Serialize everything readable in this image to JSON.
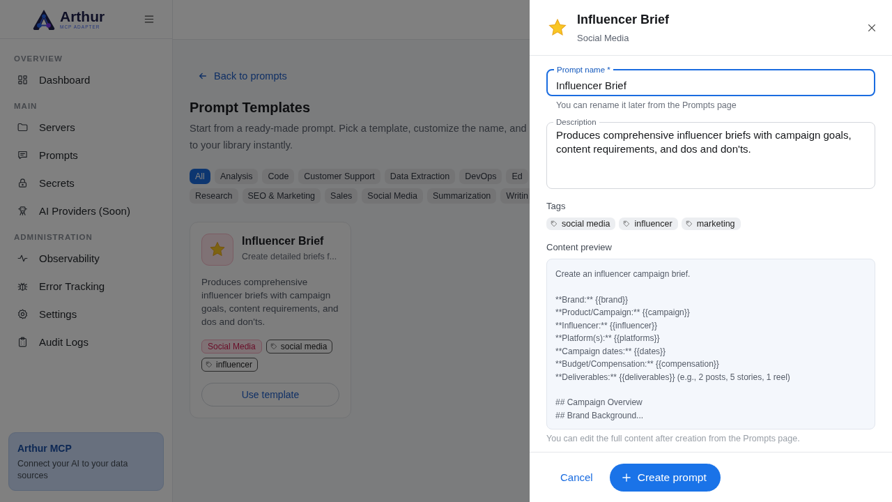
{
  "sidebar": {
    "logo": {
      "name": "Arthur",
      "tagline": "MCP ADAPTER"
    },
    "sections": [
      {
        "title": "OVERVIEW",
        "items": [
          {
            "label": "Dashboard"
          }
        ]
      },
      {
        "title": "MAIN",
        "items": [
          {
            "label": "Servers"
          },
          {
            "label": "Prompts"
          },
          {
            "label": "Secrets"
          },
          {
            "label": "AI Providers (Soon)"
          }
        ]
      },
      {
        "title": "ADMINISTRATION",
        "items": [
          {
            "label": "Observability"
          },
          {
            "label": "Error Tracking"
          },
          {
            "label": "Settings"
          },
          {
            "label": "Audit Logs"
          }
        ]
      }
    ],
    "promo": {
      "title": "Arthur MCP",
      "text": "Connect your AI to your data sources"
    }
  },
  "main": {
    "back_link": "Back to prompts",
    "title": "Prompt Templates",
    "description_lines": [
      "Start from a ready-made prompt. Pick a template, customize the name, and",
      "to your library instantly."
    ],
    "category_rows": [
      [
        {
          "label": "All",
          "selected": true
        },
        {
          "label": "Analysis",
          "selected": false
        },
        {
          "label": "Code",
          "selected": false
        },
        {
          "label": "Customer Support",
          "selected": false
        },
        {
          "label": "Data Extraction",
          "selected": false
        },
        {
          "label": "DevOps",
          "selected": false
        },
        {
          "label": "Ed",
          "selected": false
        }
      ],
      [
        {
          "label": "Research",
          "selected": false
        },
        {
          "label": "SEO & Marketing",
          "selected": false
        },
        {
          "label": "Sales",
          "selected": false
        },
        {
          "label": "Social Media",
          "selected": false
        },
        {
          "label": "Summarization",
          "selected": false
        },
        {
          "label": "Writin",
          "selected": false
        }
      ]
    ],
    "card": {
      "title": "Influencer Brief",
      "subtitle": "Create detailed briefs f...",
      "description": "Produces comprehensive influencer briefs with campaign goals, content requirements, and dos and don'ts.",
      "tags": [
        {
          "kind": "category",
          "label": "Social Media"
        },
        {
          "kind": "tag",
          "label": "social media"
        },
        {
          "kind": "tag",
          "label": "influencer"
        }
      ],
      "button": "Use template"
    }
  },
  "drawer": {
    "title": "Influencer Brief",
    "subtitle": "Social Media",
    "name_field": {
      "label": "Prompt name *",
      "value": "Influencer Brief",
      "focused": true,
      "helper": "You can rename it later from the Prompts page"
    },
    "description_field": {
      "label": "Description",
      "value": "Produces comprehensive influencer briefs with campaign goals, content requirements, and dos and don'ts.",
      "focused": false
    },
    "tags_label": "Tags",
    "tags": [
      "social media",
      "influencer",
      "marketing"
    ],
    "preview_label": "Content preview",
    "preview": [
      [
        "Create an influencer campaign brief."
      ],
      [
        "**Brand:** {{brand}}",
        "**Product/Campaign:** {{campaign}}",
        "**Influencer:** {{influencer}}",
        "**Platform(s):** {{platforms}}",
        "**Campaign dates:** {{dates}}",
        "**Budget/Compensation:** {{compensation}}",
        "**Deliverables:** {{deliverables}} (e.g., 2 posts, 5 stories, 1 reel)"
      ],
      [
        "## Campaign Overview",
        "## Brand Background..."
      ]
    ],
    "preview_note": "You can edit the full content after creation from the Prompts page.",
    "cancel": "Cancel",
    "submit": "Create prompt"
  }
}
